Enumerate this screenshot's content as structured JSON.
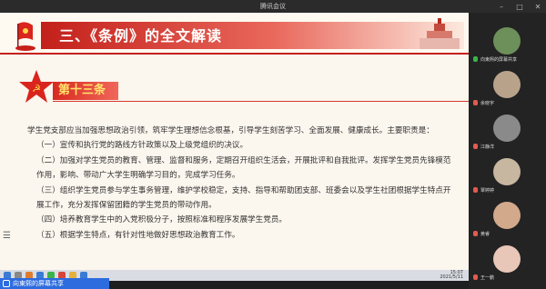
{
  "window": {
    "title": "腾讯会议"
  },
  "slide": {
    "title": "三、《条例》的全文解读",
    "article": "第十三条",
    "paragraphs": [
      "学生党支部应当加强思想政治引领，筑牢学生理想信念根基，引导学生刻苦学习、全面发展、健康成长。主要职责是：",
      "（一）宣传和执行党的路线方针政策以及上级党组织的决议。",
      "（二）加强对学生党员的教育、管理、监督和服务，定期召开组织生活会，开展批评和自我批评。发挥学生党员先锋模范作用，影响、带动广大学生明确学习目的，完成学习任务。",
      "（三）组织学生党员参与学生事务管理，维护学校稳定，支持、指导和帮助团支部、班委会以及学生社团根据学生特点开展工作，充分发挥保留团籍的学生党员的带动作用。",
      "（四）培养教育学生中的入党积极分子，按照标准和程序发展学生党员。",
      "（五）根据学生特点，有针对性地做好思想政治教育工作。"
    ]
  },
  "taskbar": {
    "time": "15:07",
    "date": "2021/5/11"
  },
  "share": {
    "label": "向東熙的屏幕共享"
  },
  "participants": [
    {
      "name": "向東熙的屏幕共享",
      "color": "#6d8f5a"
    },
    {
      "name": "余晓宇",
      "color": "#b9a28a"
    },
    {
      "name": "江静洋",
      "color": "#8a8a8a"
    },
    {
      "name": "覃婷婷",
      "color": "#c7b6a0"
    },
    {
      "name": "黄睿",
      "color": "#d3a98b"
    },
    {
      "name": "王一鹏",
      "color": "#e8c7b8"
    }
  ]
}
